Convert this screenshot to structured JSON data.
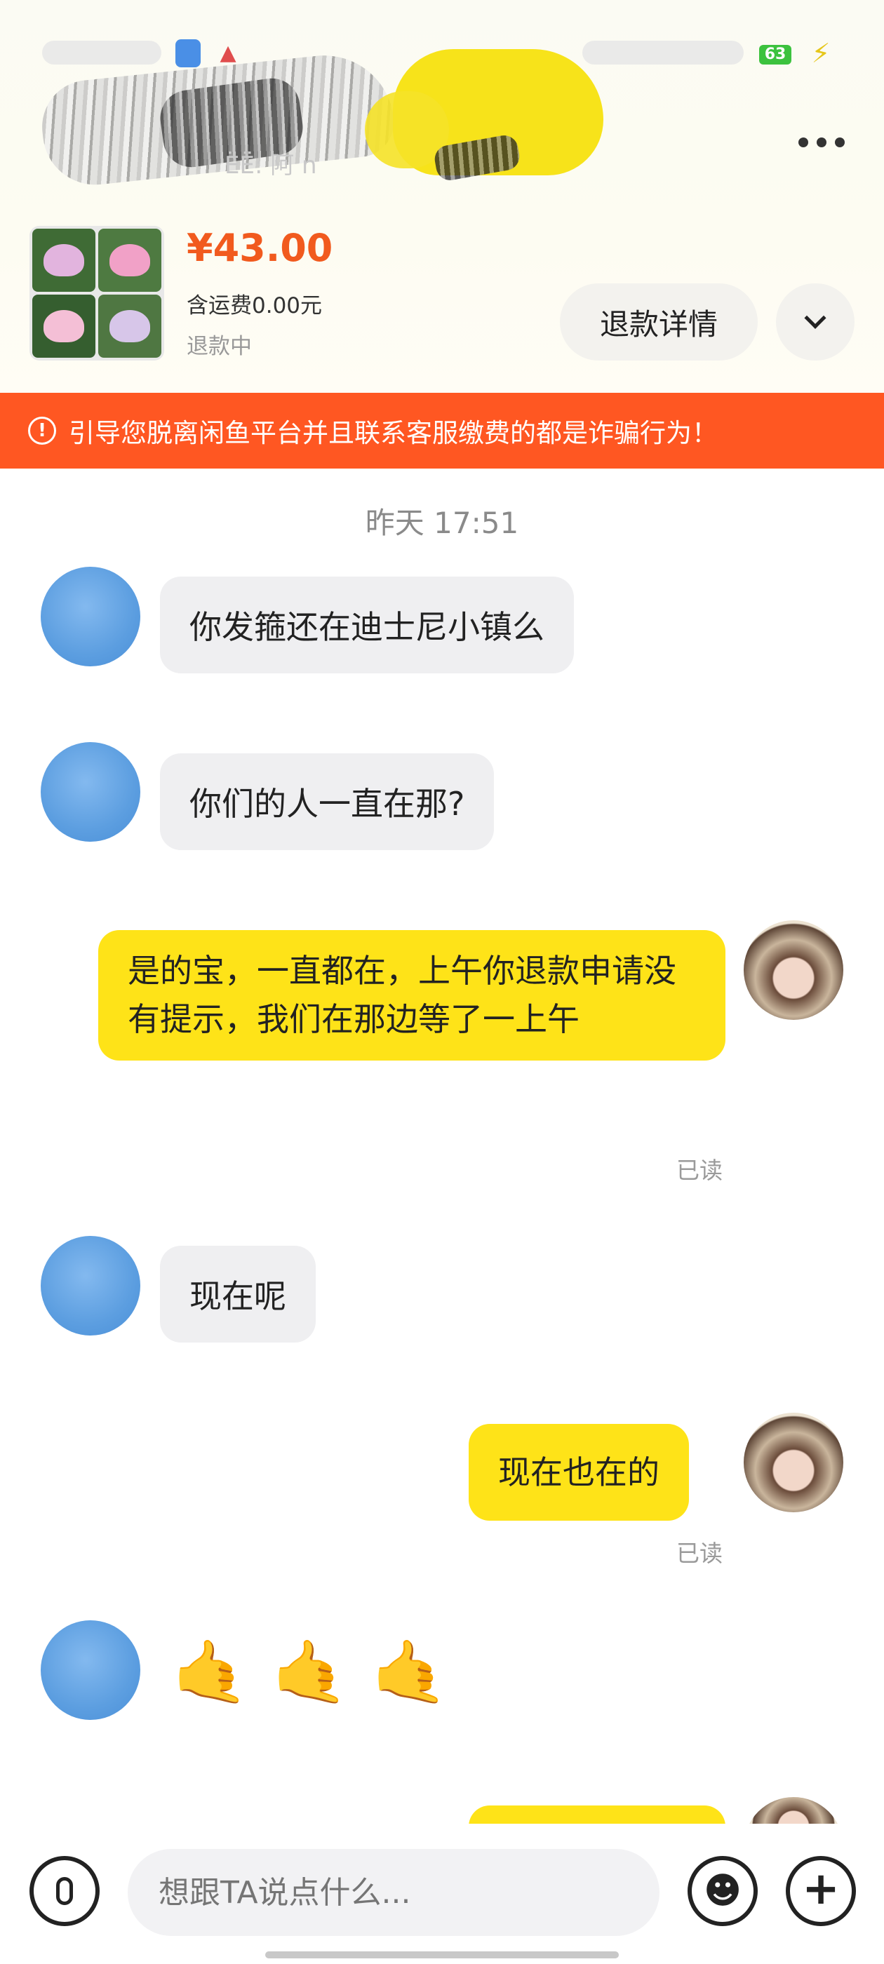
{
  "status_bar": {
    "battery": "63",
    "icons": [
      "app-icon",
      "alert-app-icon",
      "charging-icon"
    ]
  },
  "header": {
    "title_partial": "ЁЁ: 阿 n",
    "more_icon": "more-dots-icon"
  },
  "product": {
    "price": "¥43.00",
    "shipping": "含运费0.00元",
    "status": "退款中",
    "refund_details_label": "退款详情",
    "expand_icon": "chevron-down-icon"
  },
  "warning": {
    "icon": "alert-circle-icon",
    "text": "引导您脱离闲鱼平台并且联系客服缴费的都是诈骗行为！"
  },
  "chat": {
    "timestamp": "昨天 17:51",
    "messages": [
      {
        "from": "other",
        "text": "你发箍还在迪士尼小镇么"
      },
      {
        "from": "other",
        "text": "你们的人一直在那?"
      },
      {
        "from": "me",
        "text": "是的宝，一直都在，上午你退款申请没有提示，我们在那边等了一上午",
        "status": "已读"
      },
      {
        "from": "other",
        "text": "现在呢"
      },
      {
        "from": "me",
        "text": "现在也在的",
        "status": "已读"
      },
      {
        "from": "other",
        "emoji": [
          "🤙",
          "🤙",
          "🤙"
        ]
      }
    ]
  },
  "input_bar": {
    "placeholder": "想跟TA说点什么...",
    "voice_icon": "microphone-icon",
    "emoji_icon": "smile-icon",
    "plus_icon": "plus-icon"
  },
  "colors": {
    "accent_orange": "#ff5722",
    "price_orange": "#f15a1e",
    "my_bubble": "#fee318",
    "their_bubble": "#efeff1"
  }
}
